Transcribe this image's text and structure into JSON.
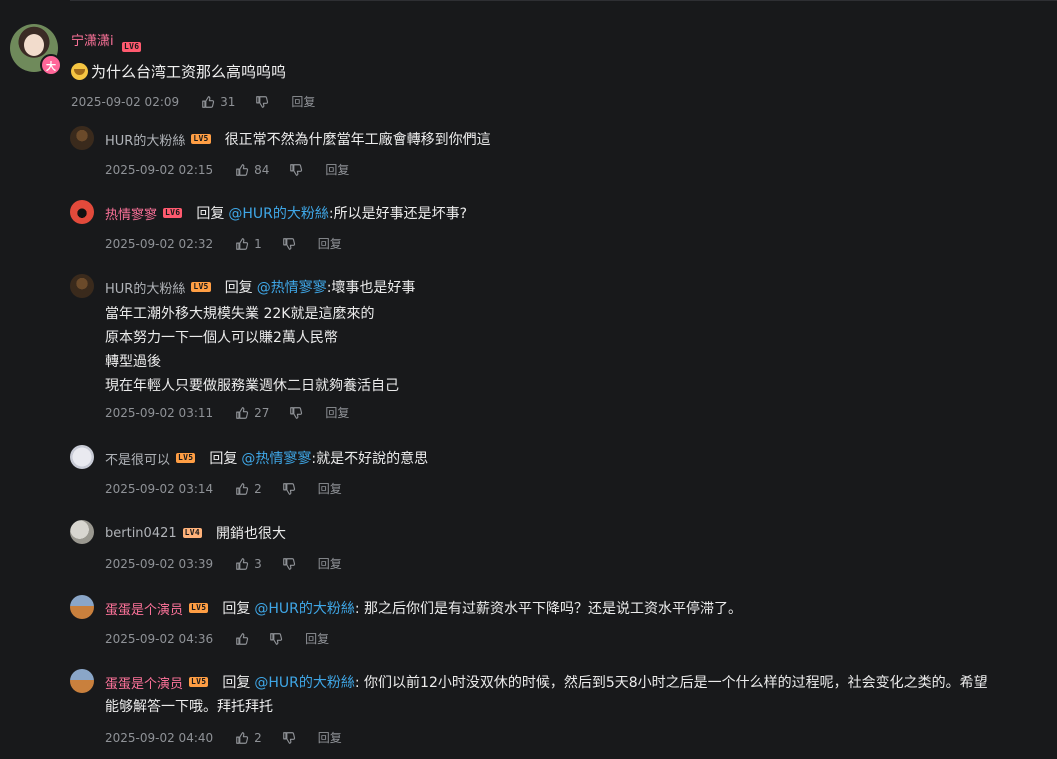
{
  "main": {
    "username": "宁潇潇i",
    "level": "LV6",
    "avatar_badge": "大",
    "text": "为什么台湾工资那么高呜呜呜",
    "time": "2025-09-02 02:09",
    "likes": "31",
    "reply_label": "回复"
  },
  "replies": [
    {
      "username": "HUR的大粉絲",
      "level": "LV5",
      "reply_word": "",
      "mention": "",
      "text": "很正常不然為什麼當年工廠會轉移到你們這",
      "time": "2025-09-02 02:15",
      "likes": "84",
      "reply_label": "回复"
    },
    {
      "username": "热情寥寥",
      "level": "LV6",
      "reply_word": "回复",
      "mention": "@HUR的大粉絲",
      "text": ":所以是好事还是坏事?",
      "time": "2025-09-02 02:32",
      "likes": "1",
      "reply_label": "回复"
    },
    {
      "username": "HUR的大粉絲",
      "level": "LV5",
      "reply_word": "回复",
      "mention": "@热情寥寥",
      "text": ":壞事也是好事",
      "lines": [
        "當年工潮外移大規模失業 22K就是這麼來的",
        "原本努力一下一個人可以賺2萬人民幣",
        "轉型過後",
        "現在年輕人只要做服務業週休二日就夠養活自己"
      ],
      "time": "2025-09-02 03:11",
      "likes": "27",
      "reply_label": "回复"
    },
    {
      "username": "不是很可以",
      "level": "LV5",
      "reply_word": "回复",
      "mention": "@热情寥寥",
      "text": ":就是不好說的意思",
      "time": "2025-09-02 03:14",
      "likes": "2",
      "reply_label": "回复"
    },
    {
      "username": "bertin0421",
      "level": "LV4",
      "reply_word": "",
      "mention": "",
      "text": "開銷也很大",
      "time": "2025-09-02 03:39",
      "likes": "3",
      "reply_label": "回复"
    },
    {
      "username": "蛋蛋是个演员",
      "level": "LV5",
      "reply_word": "回复",
      "mention": "@HUR的大粉絲",
      "text": ": 那之后你们是有过薪资水平下降吗？还是说工资水平停滞了。",
      "time": "2025-09-02 04:36",
      "likes": "",
      "reply_label": "回复"
    },
    {
      "username": "蛋蛋是个演员",
      "level": "LV5",
      "reply_word": "回复",
      "mention": "@HUR的大粉絲",
      "text": ": 你们以前12小时没双休的时候，然后到5天8小时之后是一个什么样的过程呢，社会变化之类的。希望",
      "lines": [
        "能够解答一下哦。拜托拜托"
      ],
      "time": "2025-09-02 04:40",
      "likes": "2",
      "reply_label": "回复"
    }
  ],
  "colors": {
    "background": "#18191b",
    "pink_name": "#fb7299",
    "mention_blue": "#3fa7e7",
    "meta_gray": "#8f9297"
  },
  "icons": [
    "thumbs-up-icon",
    "thumbs-down-icon"
  ]
}
